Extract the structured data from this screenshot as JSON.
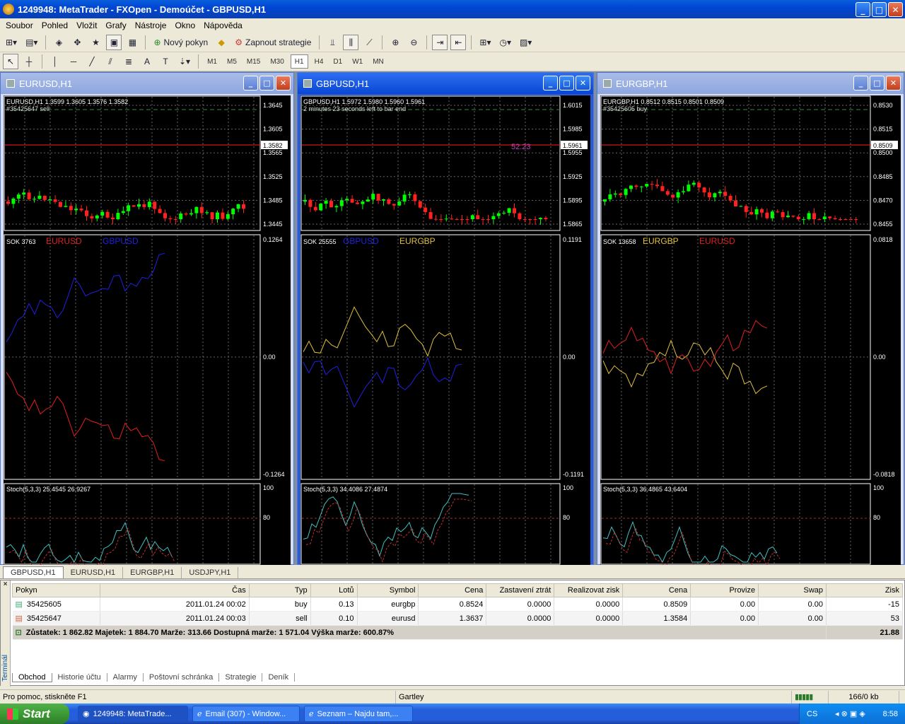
{
  "window": {
    "title": "1249948: MetaTrader - FXOpen - Demoúčet - GBPUSD,H1"
  },
  "menu": [
    "Soubor",
    "Pohled",
    "Vložit",
    "Grafy",
    "Nástroje",
    "Okno",
    "Nápověda"
  ],
  "toolbar": {
    "new_order": "Nový pokyn",
    "strategies": "Zapnout strategie"
  },
  "timeframes": [
    "M1",
    "M5",
    "M15",
    "M30",
    "H1",
    "H4",
    "D1",
    "W1",
    "MN"
  ],
  "active_timeframe": "H1",
  "charts": [
    {
      "title": "EURUSD,H1",
      "header": "EURUSD,H1  1.3599 1.3605 1.3576 1.3582",
      "order": "#35425647 sell",
      "price_ticks": [
        "1.3645",
        "1.3605",
        "1.3565",
        "1.3525",
        "1.3485",
        "1.3445"
      ],
      "current": "1.3582",
      "sok_label": "SOK 3763",
      "sok_s1": "EURUSD",
      "sok_s2": "GBPUSD",
      "sok_s1_color": "#e02020",
      "sok_s2_color": "#2020e0",
      "sok_ticks": [
        "0.1264",
        "0.00",
        "-0.1264"
      ],
      "stoch_label": "Stoch(5,3,3) 25.4545 26.9267",
      "stoch_ticks": [
        "100",
        "80"
      ]
    },
    {
      "title": "GBPUSD,H1",
      "header": "GBPUSD,H1  1.5972 1.5980 1.5960 1.5961",
      "order": "2 minutes 23 seconds left to bar end",
      "price_ticks": [
        "1.6015",
        "1.5985",
        "1.5955",
        "1.5925",
        "1.5895",
        "1.5865"
      ],
      "current": "1.5961",
      "order_value": "52.23",
      "sok_label": "SOK 25555",
      "sok_s1": "GBPUSD",
      "sok_s2": "EURGBP",
      "sok_s1_color": "#2020e0",
      "sok_s2_color": "#e0c040",
      "sok_ticks": [
        "0.1191",
        "0.00",
        "-0.1191"
      ],
      "stoch_label": "Stoch(5,3,3) 34.4086 27.4874",
      "stoch_ticks": [
        "100",
        "80"
      ]
    },
    {
      "title": "EURGBP,H1",
      "header": "EURGBP,H1  0.8512 0.8515 0.8501 0.8509",
      "order": "#35425605 buy",
      "price_ticks": [
        "0.8530",
        "0.8515",
        "0.8500",
        "0.8485",
        "0.8470",
        "0.8455"
      ],
      "current": "0.8509",
      "sok_label": "SOK 13658",
      "sok_s1": "EURGBP",
      "sok_s2": "EURUSD",
      "sok_s1_color": "#e0c040",
      "sok_s2_color": "#e02020",
      "sok_ticks": [
        "0.0818",
        "0.00",
        "-0.0818"
      ],
      "stoch_label": "Stoch(5,3,3) 36.4865 43.6404",
      "stoch_ticks": [
        "100",
        "80"
      ]
    }
  ],
  "chart_tabs": [
    "GBPUSD,H1",
    "EURUSD,H1",
    "EURGBP,H1",
    "USDJPY,H1"
  ],
  "terminal": {
    "side_label": "Terminál",
    "columns": [
      "Pokyn",
      "Čas",
      "Typ",
      "Lotů",
      "Symbol",
      "Cena",
      "Zastavení ztrát",
      "Realizovat zisk",
      "Cena",
      "Provize",
      "Swap",
      "Zisk"
    ],
    "rows": [
      [
        "35425605",
        "2011.01.24 00:02",
        "buy",
        "0.13",
        "eurgbp",
        "0.8524",
        "0.0000",
        "0.0000",
        "0.8509",
        "0.00",
        "0.00",
        "-15"
      ],
      [
        "35425647",
        "2011.01.24 00:03",
        "sell",
        "0.10",
        "eurusd",
        "1.3637",
        "0.0000",
        "0.0000",
        "1.3584",
        "0.00",
        "0.00",
        "53"
      ]
    ],
    "summary": "Zůstatek: 1 862.82  Majetek: 1 884.70  Marže: 313.66  Dostupná marže: 1 571.04  Výška marže: 600.87%",
    "summary_total": "21.88",
    "tabs": [
      "Obchod",
      "Historie účtu",
      "Alarmy",
      "Poštovní schránka",
      "Strategie",
      "Deník"
    ]
  },
  "status": {
    "help": "Pro pomoc, stiskněte F1",
    "profile": "Gartley",
    "traffic": "166/0 kb"
  },
  "taskbar": {
    "start": "Start",
    "tasks": [
      "1249948: MetaTrade...",
      "Email (307) - Window...",
      "Seznam – Najdu tam,..."
    ],
    "lang": "CS",
    "clock": "8:58"
  }
}
